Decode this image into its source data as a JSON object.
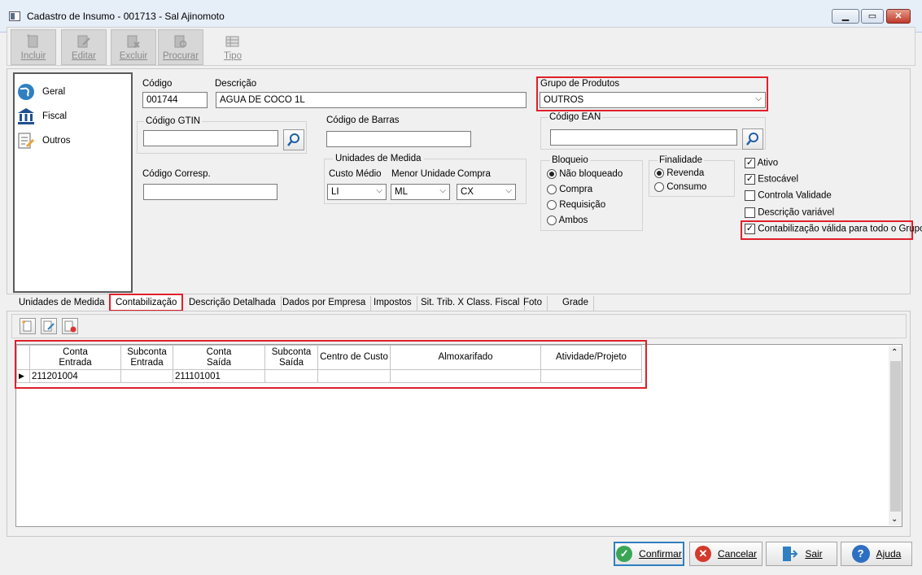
{
  "window": {
    "title": "Cadastro de Insumo - 001713 - Sal Ajinomoto"
  },
  "toolbar": {
    "buttons": [
      {
        "label": "Incluir"
      },
      {
        "label": "Editar"
      },
      {
        "label": "Excluir"
      },
      {
        "label": "Procurar"
      },
      {
        "label": "Tipo"
      }
    ]
  },
  "nav": {
    "items": [
      {
        "label": "Geral",
        "icon": "globe-icon"
      },
      {
        "label": "Fiscal",
        "icon": "bank-icon"
      },
      {
        "label": "Outros",
        "icon": "document-edit-icon"
      }
    ]
  },
  "form": {
    "codigo_label": "Código",
    "codigo_value": "001744",
    "descricao_label": "Descrição",
    "descricao_value": "AGUA DE COCO 1L",
    "grupo_label": "Grupo de Produtos",
    "grupo_value": "OUTROS",
    "gtin_label": "Código GTIN",
    "gtin_value": "",
    "barras_label": "Código de Barras",
    "barras_value": "",
    "ean_label": "Código EAN",
    "ean_value": "",
    "corresp_label": "Código Corresp.",
    "corresp_value": "",
    "unidades": {
      "title": "Unidades de Medida",
      "custo_label": "Custo Médio",
      "custo_value": "LI",
      "menor_label": "Menor Unidade",
      "menor_value": "ML",
      "compra_label": "Compra",
      "compra_value": "CX"
    },
    "bloqueio": {
      "title": "Bloqueio",
      "options": [
        "Não bloqueado",
        "Compra",
        "Requisição",
        "Ambos"
      ],
      "selected": "Não bloqueado"
    },
    "finalidade": {
      "title": "Finalidade",
      "options": [
        "Revenda",
        "Consumo"
      ],
      "selected": "Revenda"
    },
    "checks": [
      {
        "label": "Ativo",
        "checked": true
      },
      {
        "label": "Estocável",
        "checked": true
      },
      {
        "label": "Controla Validade",
        "checked": false
      },
      {
        "label": "Descrição variável",
        "checked": false
      },
      {
        "label": "Contabilização válida para todo o Grupo",
        "checked": true
      }
    ]
  },
  "tabs": [
    "Unidades de Medida",
    "Contabilização",
    "Descrição Detalhada",
    "Dados por Empresa",
    "Impostos",
    "Sit. Trib. X Class. Fiscal",
    "Foto",
    "Grade"
  ],
  "active_tab": "Contabilização",
  "grid": {
    "headers": [
      [
        "Conta",
        "Entrada"
      ],
      [
        "Subconta",
        "Entrada"
      ],
      [
        "Conta",
        "Saída"
      ],
      [
        "Subconta",
        "Saída"
      ],
      [
        "Centro de Custo"
      ],
      [
        "Almoxarifado"
      ],
      [
        "Atividade/Projeto"
      ]
    ],
    "rows": [
      [
        "211201004",
        "",
        "211101001",
        "",
        "",
        "",
        ""
      ]
    ]
  },
  "buttons": {
    "confirmar": "Confirmar",
    "cancelar": "Cancelar",
    "sair": "Sair",
    "ajuda": "Ajuda"
  },
  "colors": {
    "highlight": "#e0202a",
    "accent": "#2f7fc1"
  }
}
